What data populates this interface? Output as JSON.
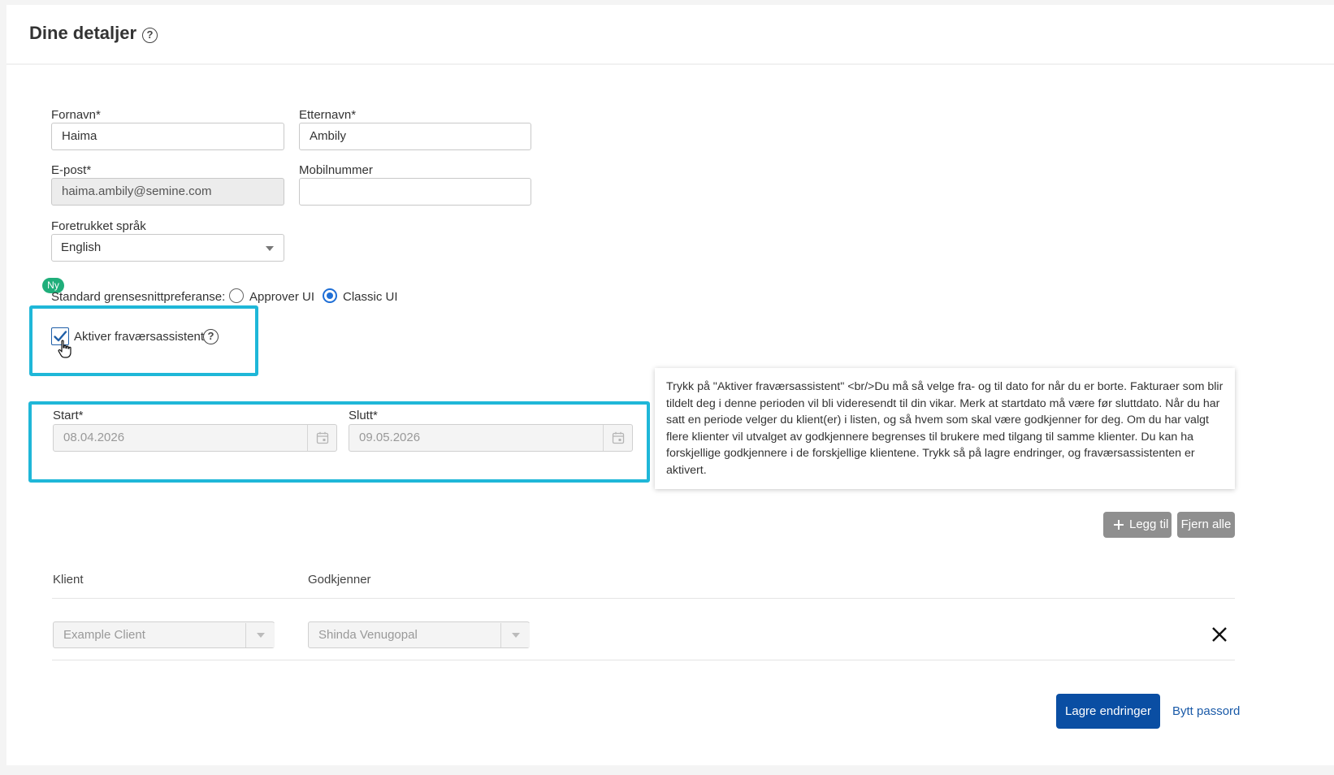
{
  "page": {
    "title": "Dine detaljer"
  },
  "form": {
    "first_name": {
      "label": "Fornavn*",
      "value": "Haima"
    },
    "last_name": {
      "label": "Etternavn*",
      "value": "Ambily"
    },
    "email": {
      "label": "E-post*",
      "value": "haima.ambily@semine.com"
    },
    "mobile": {
      "label": "Mobilnummer",
      "value": ""
    },
    "language": {
      "label": "Foretrukket språk",
      "selected": "English"
    }
  },
  "interface_pref": {
    "badge": "Ny",
    "label": "Standard grensesnittpreferanse:",
    "options": [
      {
        "label": "Approver UI",
        "selected": false
      },
      {
        "label": "Classic UI",
        "selected": true
      }
    ]
  },
  "absence_assistant": {
    "checkbox_label": "Aktiver fraværsassistent",
    "checked": true,
    "start": {
      "label": "Start*",
      "value": "08.04.2026"
    },
    "end": {
      "label": "Slutt*",
      "value": "09.05.2026"
    }
  },
  "tooltip": {
    "text": "Trykk på \"Aktiver fraværsassistent\" <br/>Du må så velge fra- og til dato for når du er borte. Fakturaer som blir tildelt deg i denne perioden vil bli videresendt til din vikar. Merk at startdato må være før sluttdato. Når du har satt en periode velger du klient(er) i listen, og så hvem som skal være godkjenner for deg. Om du har valgt flere klienter vil utvalget av godkjennere begrenses til brukere med tilgang til samme klienter. Du kan ha forskjellige godkjennere i de forskjellige klientene. Trykk så på lagre endringer, og fraværsassistenten er aktivert."
  },
  "actions": {
    "add_label": "Legg til",
    "remove_all_label": "Fjern alle",
    "save_label": "Lagre endringer",
    "change_password_label": "Bytt passord"
  },
  "table": {
    "columns": [
      "Klient",
      "Godkjenner"
    ],
    "rows": [
      {
        "client": "Example Client",
        "approver": "Shinda Venugopal"
      }
    ]
  },
  "colors": {
    "primary": "#0a4ea3",
    "highlight": "#1fb7d8",
    "badge": "#1fae7a",
    "radio_active": "#1f6fd6"
  },
  "icons": [
    "help-icon",
    "checkmark-icon",
    "calendar-icon",
    "plus-icon",
    "close-icon",
    "chevron-down-icon",
    "hand-cursor-icon"
  ]
}
